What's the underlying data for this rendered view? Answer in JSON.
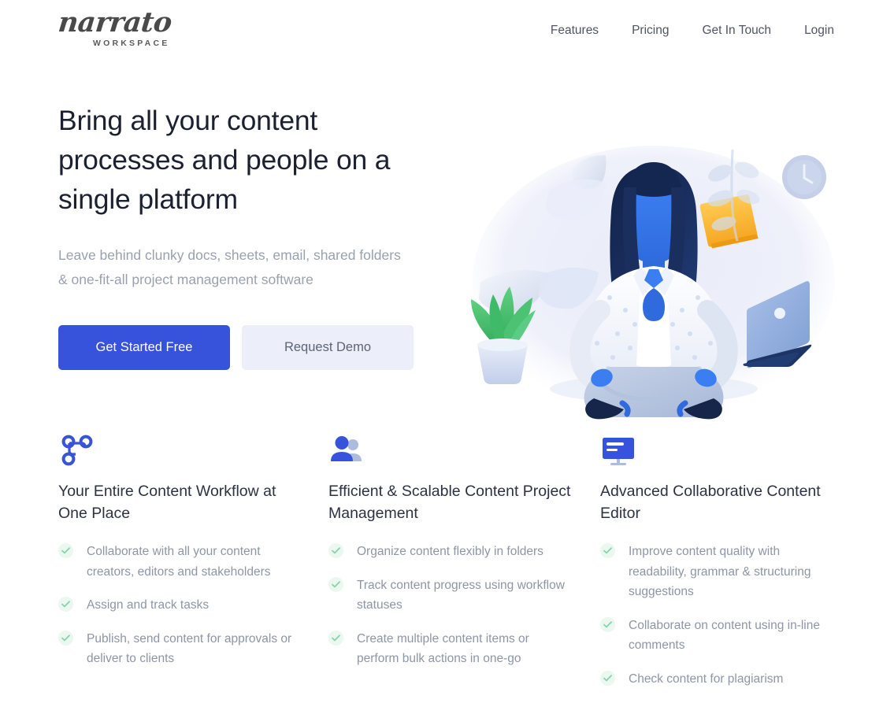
{
  "brand": {
    "logo_word": "narrato",
    "logo_sub": "WORKSPACE"
  },
  "nav": {
    "items": [
      {
        "label": "Features"
      },
      {
        "label": "Pricing"
      },
      {
        "label": "Get In Touch"
      },
      {
        "label": "Login"
      }
    ]
  },
  "hero": {
    "title": "Bring all your content processes and people on a single platform",
    "subtitle": "Leave behind clunky docs, sheets, email, shared folders & one-fit-all project management software",
    "primary_cta": "Get Started Free",
    "secondary_cta": "Request Demo",
    "illustration": {
      "name": "meditating-woman-illustration",
      "elements": [
        "meditating-woman",
        "floating-papers",
        "potted-plant",
        "wall-clock",
        "sticky-note",
        "laptop",
        "leaf-branch"
      ]
    }
  },
  "features": {
    "columns": [
      {
        "icon": "workflow-icon",
        "title": "Your Entire Content Workflow at One Place",
        "items": [
          "Collaborate with all your content creators, editors and stakeholders",
          "Assign and track tasks",
          "Publish, send content for approvals or deliver to clients"
        ]
      },
      {
        "icon": "people-icon",
        "title": "Efficient & Scalable Content Project Management",
        "items": [
          "Organize content flexibly in folders",
          "Track content progress using workflow statuses",
          "Create multiple content items or perform bulk actions in one-go"
        ]
      },
      {
        "icon": "monitor-icon",
        "title": "Advanced Collaborative Content Editor",
        "items": [
          "Improve content quality with readability, grammar & structuring suggestions",
          "Collaborate on content using in-line comments",
          "Check content for plagiarism"
        ]
      }
    ]
  },
  "colors": {
    "brand_blue": "#3853db",
    "secondary_button_bg": "#eceef9",
    "heading": "#1b2130",
    "body_text": "#8e96a5",
    "check_green": "#86d3ac"
  }
}
